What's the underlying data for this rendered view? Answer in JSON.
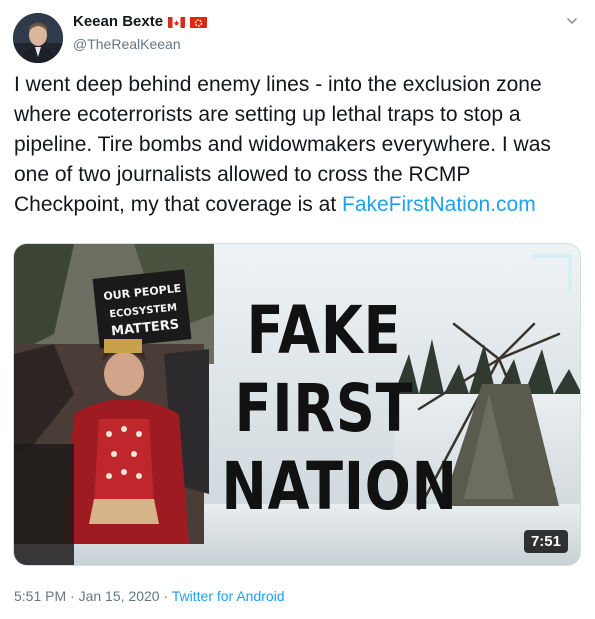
{
  "author": {
    "name": "Keean Bexte",
    "handle": "@TheRealKeean",
    "flags": [
      "canada-flag-icon",
      "hong-kong-flag-icon"
    ]
  },
  "tweet": {
    "text_before_link": "I went deep behind enemy lines - into the exclusion zone where ecoterrorists are setting up lethal traps to stop a pipeline. Tire bombs and widowmakers everywhere. I was one of two journalists allowed to cross the RCMP Checkpoint, my that coverage is at ",
    "link_text": "FakeFirstNation.com"
  },
  "media": {
    "headline_lines": [
      "FAKE",
      "FIRST",
      "NATION"
    ],
    "banner_lines": [
      "OUR PEOPLE",
      "ECOSYSTEM",
      "MATTERS"
    ],
    "duration": "7:51"
  },
  "meta": {
    "time": "5:51 PM",
    "separator": " · ",
    "date": "Jan 15, 2020",
    "source": "Twitter for Android"
  },
  "colors": {
    "link": "#1da1f2",
    "muted": "#657786"
  }
}
